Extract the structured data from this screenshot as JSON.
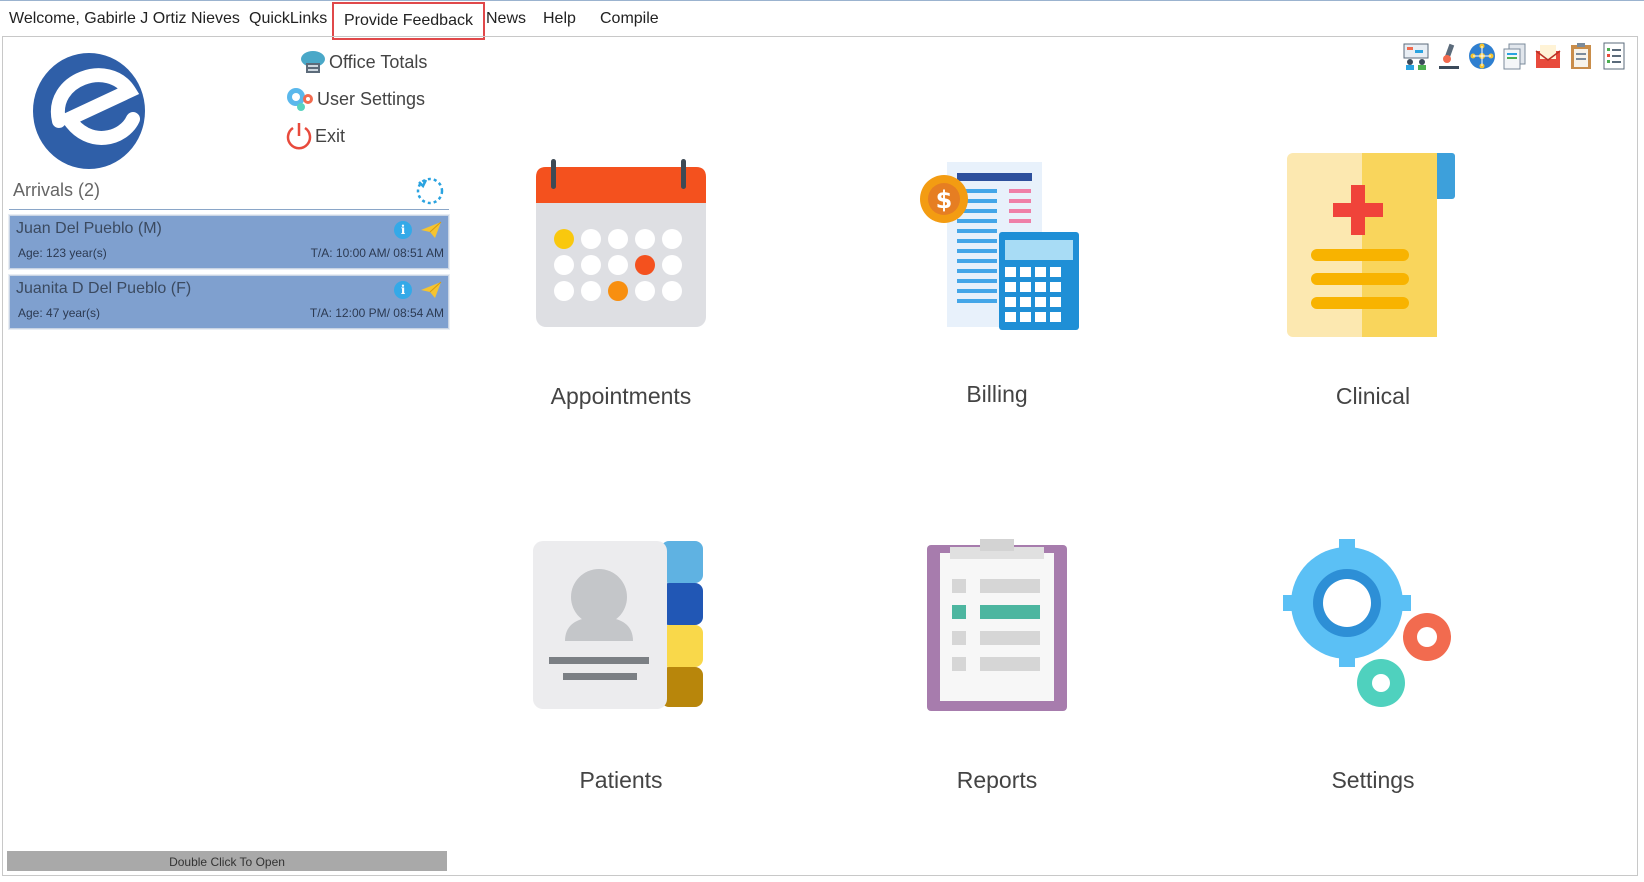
{
  "menu": {
    "welcome": "Welcome, Gabirle J Ortiz Nieves",
    "quicklinks": "QuickLinks",
    "feedback": "Provide Feedback",
    "news": "News",
    "help": "Help",
    "compile": "Compile"
  },
  "quick_actions": {
    "office_totals": "Office Totals",
    "user_settings": "User Settings",
    "exit": "Exit"
  },
  "arrivals": {
    "title": "Arrivals (2)",
    "patients": [
      {
        "name": "Juan Del Pueblo (M)",
        "age": "Age: 123 year(s)",
        "ta": "T/A: 10:00 AM/ 08:51 AM"
      },
      {
        "name": "Juanita D Del Pueblo (F)",
        "age": "Age: 47 year(s)",
        "ta": "T/A: 12:00 PM/ 08:54 AM"
      }
    ],
    "footer": "Double Click To Open"
  },
  "tiles": {
    "appointments": "Appointments",
    "billing": "Billing",
    "clinical": "Clinical",
    "patients": "Patients",
    "reports": "Reports",
    "settings": "Settings"
  },
  "top_icons": [
    "meeting-icon",
    "microscope-icon",
    "network-icon",
    "documents-icon",
    "mail-icon",
    "clipboard-icon",
    "checklist-icon"
  ],
  "colors": {
    "accent": "#2f5fa8",
    "feedback_highlight": "#e0484a",
    "arrival_card": "#7fa0cf"
  }
}
